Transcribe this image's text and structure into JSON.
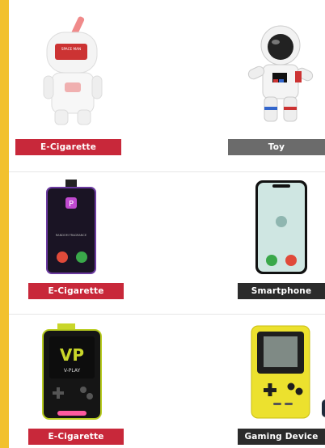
{
  "products": [
    {
      "name": "ecig-astronaut",
      "label": "E-Cigarette",
      "label_color": "#c8283a",
      "screen_text": "SPACE MAN"
    },
    {
      "name": "toy-astronaut",
      "label": "Toy",
      "label_color": "#6b6b6b"
    },
    {
      "name": "ecig-phone",
      "label": "E-Cigarette",
      "label_color": "#c8283a",
      "screen_text": "RANDOM FRAGRANCE"
    },
    {
      "name": "smartphone",
      "label": "Smartphone",
      "label_color": "#2b2b2b"
    },
    {
      "name": "ecig-vplay",
      "label": "E-Cigarette",
      "label_color": "#c8283a",
      "brand_text": "V-PLAY"
    },
    {
      "name": "gaming-device",
      "label": "Gaming Device",
      "label_color": "#2b2b2b"
    }
  ],
  "icons": [
    "astronaut-vape-icon",
    "astronaut-toy-icon",
    "phone-vape-icon",
    "smartphone-icon",
    "gameboy-vape-icon",
    "gameboy-icon"
  ]
}
